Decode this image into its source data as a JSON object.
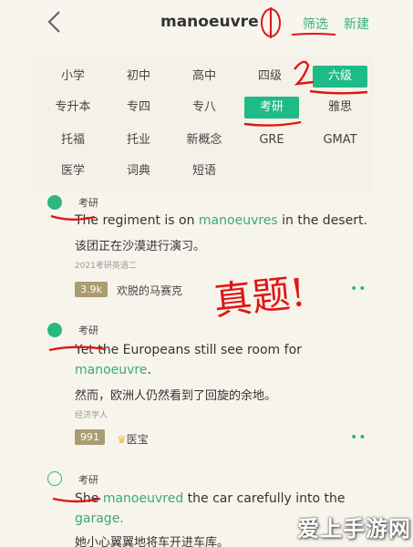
{
  "header": {
    "title": "manoeuvre",
    "filter_label": "筛选",
    "new_label": "新建"
  },
  "filters": [
    {
      "label": "小学",
      "active": false
    },
    {
      "label": "初中",
      "active": false
    },
    {
      "label": "高中",
      "active": false
    },
    {
      "label": "四级",
      "active": false
    },
    {
      "label": "六级",
      "active": true
    },
    {
      "label": "专升本",
      "active": false
    },
    {
      "label": "专四",
      "active": false
    },
    {
      "label": "专八",
      "active": false
    },
    {
      "label": "考研",
      "active": true
    },
    {
      "label": "雅思",
      "active": false
    },
    {
      "label": "托福",
      "active": false
    },
    {
      "label": "托业",
      "active": false
    },
    {
      "label": "新概念",
      "active": false
    },
    {
      "label": "GRE",
      "active": false
    },
    {
      "label": "GMAT",
      "active": false
    },
    {
      "label": "医学",
      "active": false
    },
    {
      "label": "词典",
      "active": false
    },
    {
      "label": "短语",
      "active": false
    }
  ],
  "sentences": [
    {
      "tag": "考研",
      "checked": true,
      "en_before": "The regiment is on ",
      "en_highlight": "manoeuvres",
      "en_after": " in the desert.",
      "zh": "该团正在沙漠进行演习。",
      "source": "2021考研英语二",
      "count": "3.9k",
      "user": "欢脱的马赛克"
    },
    {
      "tag": "考研",
      "checked": true,
      "en_line1": "Yet the Europeans still see room for",
      "en_highlight": "manoeuvre",
      "en_after": ".",
      "zh": "然而，欧洲人仍然看到了回旋的余地。",
      "source": "经济学人",
      "count": "991",
      "user": "医宝"
    },
    {
      "tag": "考研",
      "checked": false,
      "en_before": "She ",
      "en_highlight": "manoeuvred",
      "en_after": " the car carefully into the",
      "en_line2": "garage.",
      "zh": "她小心翼翼地将车开进车库。"
    }
  ],
  "annotations": {
    "circle_one": "①",
    "circle_two": "②",
    "handwriting": "真题!"
  },
  "watermark": "爱上手游网",
  "colors": {
    "accent": "#1fbb87",
    "annotation_red": "#e01515",
    "badge": "#ab9b70"
  }
}
